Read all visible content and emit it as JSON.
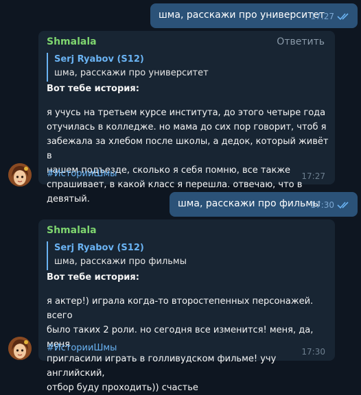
{
  "messages": {
    "out1": {
      "text": "шма, расскажи про университет",
      "time": "17:27"
    },
    "in1": {
      "sender": "Shmalala",
      "reply_label": "Ответить",
      "quote_author": "Serj Ryabov (S12)",
      "quote_text": "шма, расскажи про университет",
      "title": "Вот тебе история:",
      "body_lines": [
        "я учусь на третьем курсе института, до этого четыре года",
        "отучилась в колледже. но мама до сих пор говорит, чтоб я",
        "забежала за хлебом после школы, а дедок, который живёт в",
        "нашем подъезде, сколько я себя помню, все также",
        "спрашивает, в какой класс я перешла. отвечаю, что в девятый."
      ],
      "hashtag": "#ИсторииШмы",
      "time": "17:27"
    },
    "out2": {
      "text": "шма, расскажи про фильмы",
      "time": "17:30"
    },
    "in2": {
      "sender": "Shmalala",
      "quote_author": "Serj Ryabov (S12)",
      "quote_text": "шма, расскажи про фильмы",
      "title": "Вот тебе история:",
      "body_lines": [
        "я актер!) играла когда-то второстепенных персонажей. всего",
        "было таких 2 роли. но сегодня все изменится! меня, да, меня",
        "пригласили играть в голливудском фильме! учу английский,",
        "отбор буду проходить)) счастье"
      ],
      "hashtag": "#ИсторииШмы",
      "time": "17:30"
    }
  },
  "icons": {
    "read_status": "double-check-icon",
    "avatar": "avatar-shmalala"
  },
  "colors": {
    "background": "#0e1621",
    "outgoing_bubble": "#2b5278",
    "incoming_bubble": "#182533",
    "sender_name": "#7ed56f",
    "link_accent": "#6ab3f3"
  }
}
